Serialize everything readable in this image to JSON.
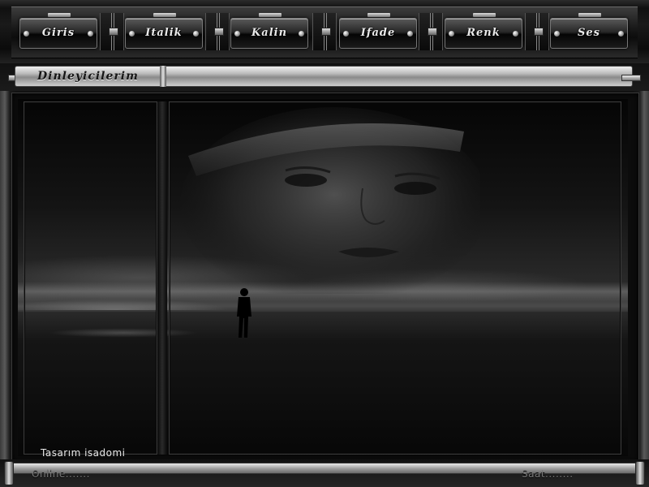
{
  "menu": {
    "items": [
      {
        "label": "Giris"
      },
      {
        "label": "Italik"
      },
      {
        "label": "Kalin"
      },
      {
        "label": "Ifade"
      },
      {
        "label": "Renk"
      },
      {
        "label": "Ses"
      }
    ]
  },
  "title": {
    "text": "Dinleyicilerim"
  },
  "footer": {
    "credit": "Tasarım isadomi",
    "online_label": "Online.......",
    "clock_label": "Saat........"
  },
  "colors": {
    "background": "#111111",
    "chrome": "#bdbdbd",
    "button_text": "#eaeaea",
    "title_text": "#151515",
    "status_text": "#777777"
  },
  "icons": {
    "separator": "chrome-chain-link-icon",
    "button_stud": "rivet-icon"
  }
}
